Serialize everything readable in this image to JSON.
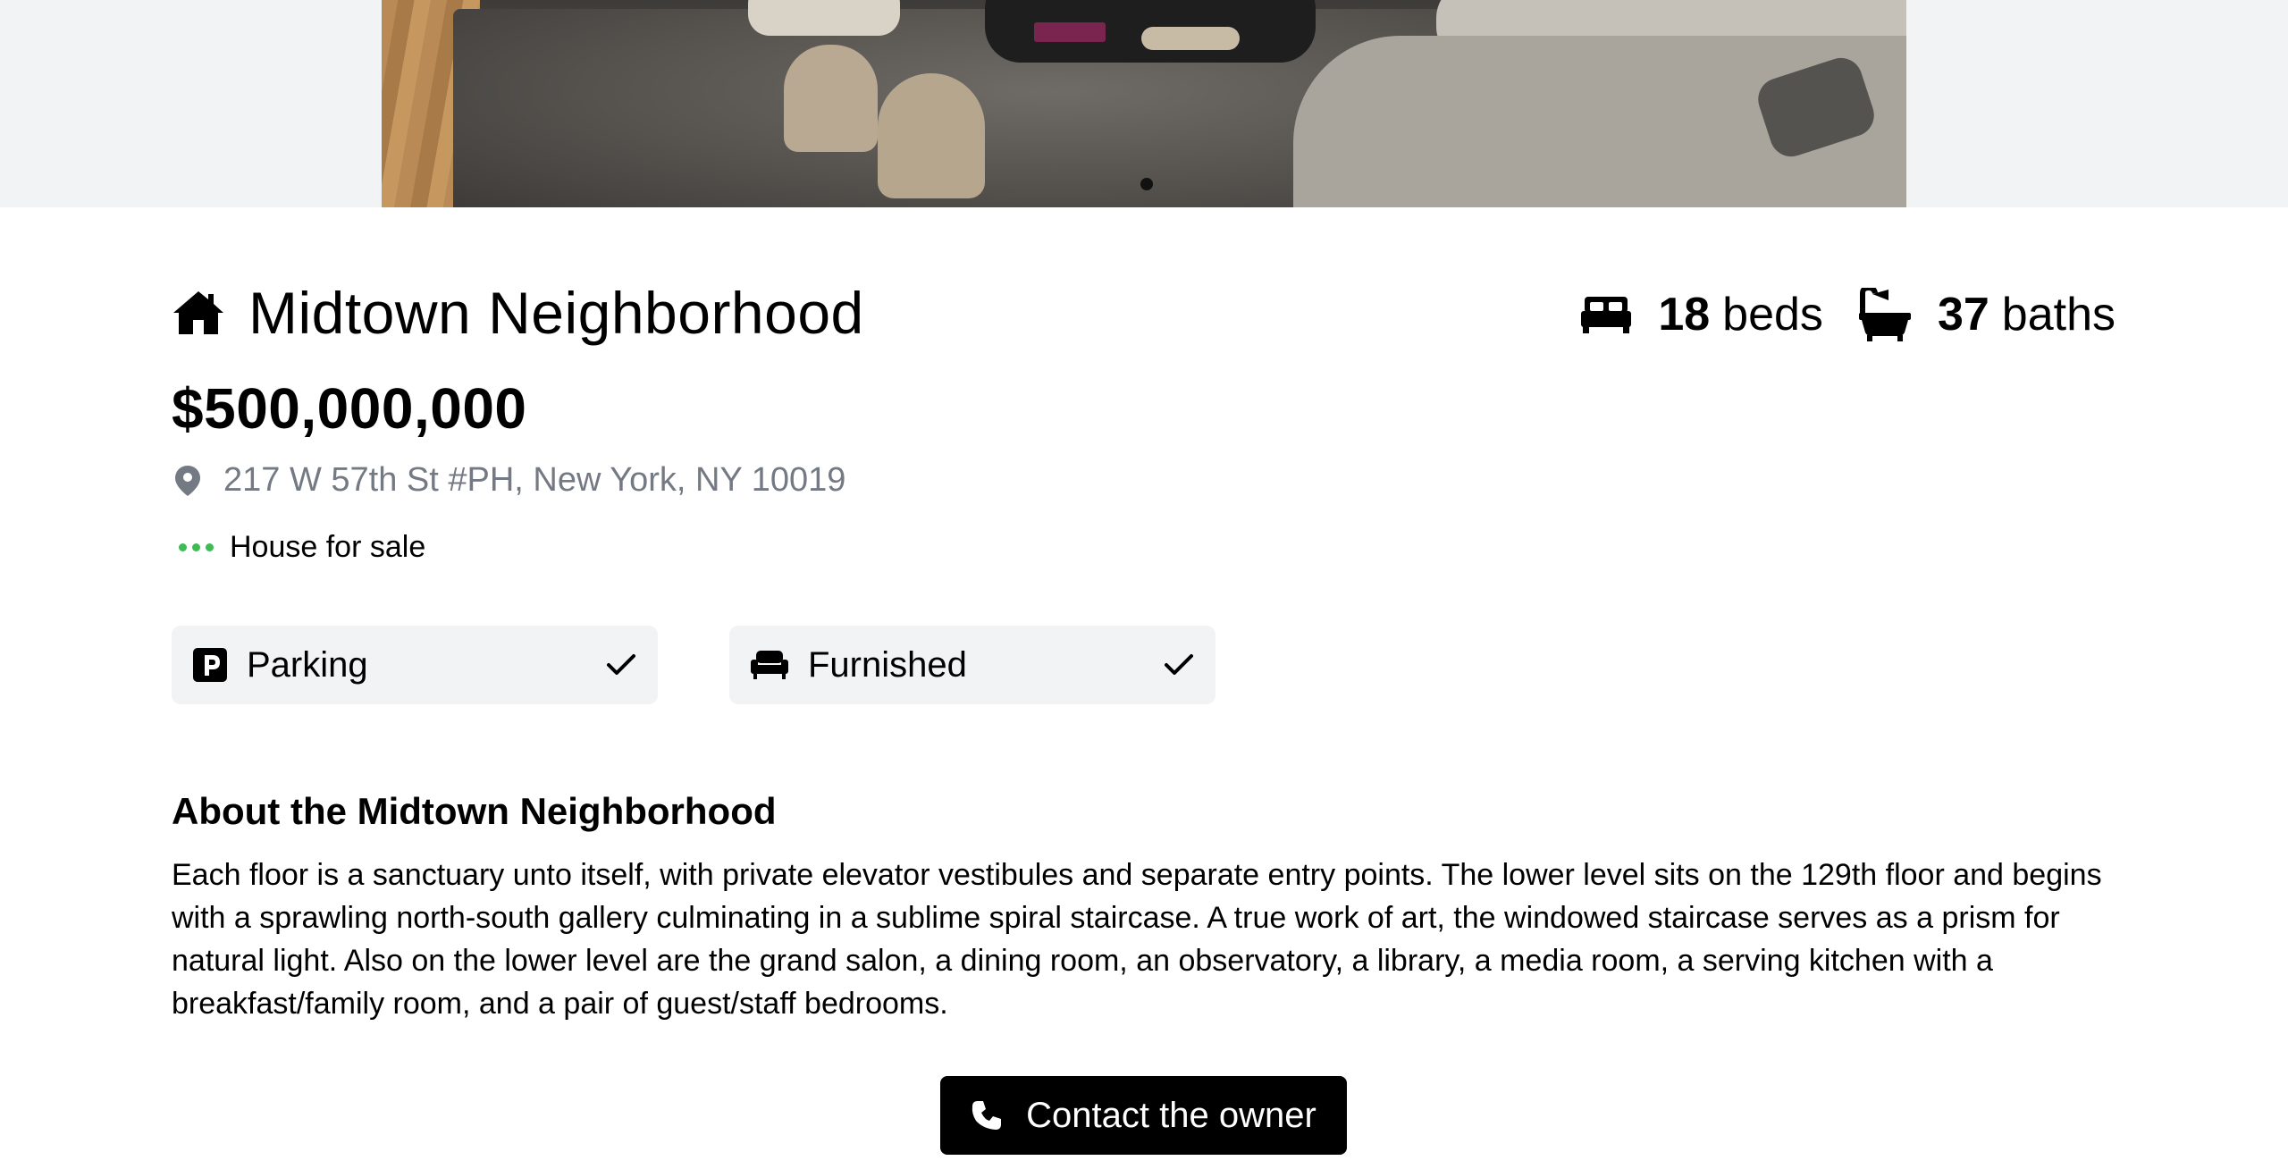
{
  "listing": {
    "title": "Midtown Neighborhood",
    "price": "$500,000,000",
    "address": "217 W 57th St #PH, New York, NY 10019",
    "type": "House for sale",
    "beds_count": "18",
    "beds_label": "beds",
    "baths_count": "37",
    "baths_label": "baths"
  },
  "gallery": {
    "active_slide_indicator": 1
  },
  "features": [
    {
      "label": "Parking",
      "icon": "parking-icon",
      "checked": true
    },
    {
      "label": "Furnished",
      "icon": "sofa-icon",
      "checked": true
    }
  ],
  "about": {
    "heading": "About the Midtown Neighborhood",
    "text": "Each floor is a sanctuary unto itself, with private elevator vestibules and separate entry points. The lower level sits on the 129th floor and begins with a sprawling north-south gallery culminating in a sublime spiral staircase. A true work of art, the windowed staircase serves as a prism for natural light. Also on the lower level are the grand salon, a dining room, an observatory, a library, a media room, a serving kitchen with a breakfast/family room, and a pair of guest/staff bedrooms."
  },
  "contact": {
    "label": "Contact the owner"
  },
  "colors": {
    "accent": "#000000",
    "status_dots": "#3dbb55",
    "muted_text": "#737a84",
    "chip_bg": "#f2f3f5"
  }
}
